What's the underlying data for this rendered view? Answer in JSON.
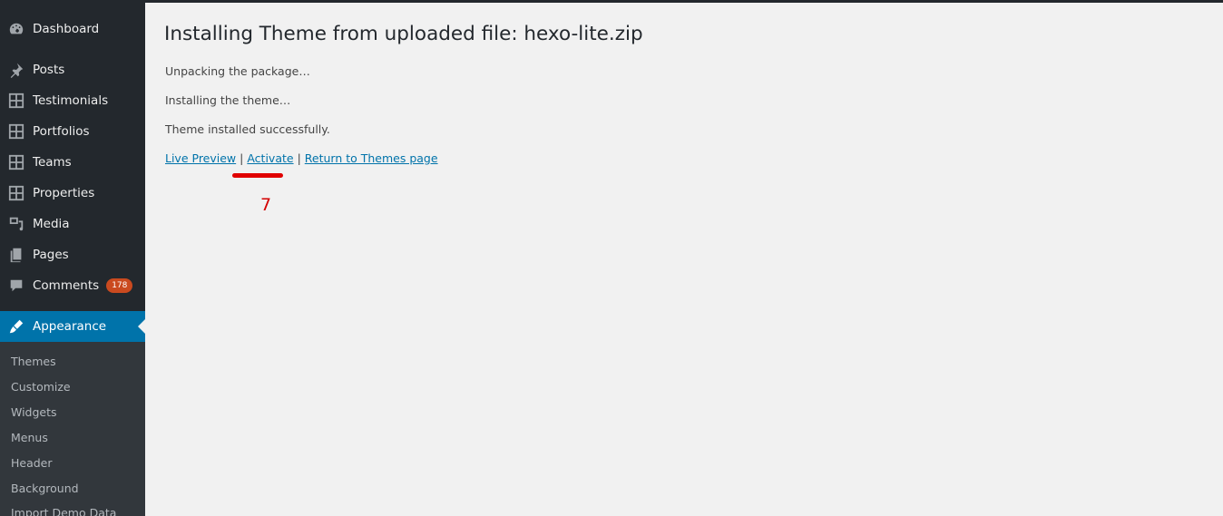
{
  "sidebar": {
    "items": [
      {
        "label": "Dashboard",
        "icon": "dashboard-icon"
      },
      {
        "label": "Posts",
        "icon": "pin-icon"
      },
      {
        "label": "Testimonials",
        "icon": "grid-icon"
      },
      {
        "label": "Portfolios",
        "icon": "grid-icon"
      },
      {
        "label": "Teams",
        "icon": "grid-icon"
      },
      {
        "label": "Properties",
        "icon": "grid-icon"
      },
      {
        "label": "Media",
        "icon": "media-icon"
      },
      {
        "label": "Pages",
        "icon": "pages-icon"
      },
      {
        "label": "Comments",
        "icon": "comment-icon",
        "badge": "178"
      },
      {
        "label": "Appearance",
        "icon": "brush-icon",
        "active": true
      }
    ],
    "submenu": [
      "Themes",
      "Customize",
      "Widgets",
      "Menus",
      "Header",
      "Background",
      "Import Demo Data"
    ]
  },
  "main": {
    "title": "Installing Theme from uploaded file: hexo-lite.zip",
    "messages": [
      "Unpacking the package…",
      "Installing the theme…",
      "Theme installed successfully."
    ],
    "links": {
      "live_preview": "Live Preview",
      "activate": "Activate",
      "return": "Return to Themes page",
      "separator": "|"
    }
  },
  "annotation": {
    "step": "7"
  },
  "colors": {
    "sidebar": "#23282d",
    "active": "#0073aa",
    "link": "#0073aa",
    "annotation": "#e00000",
    "badge": "#ca4a1f"
  }
}
